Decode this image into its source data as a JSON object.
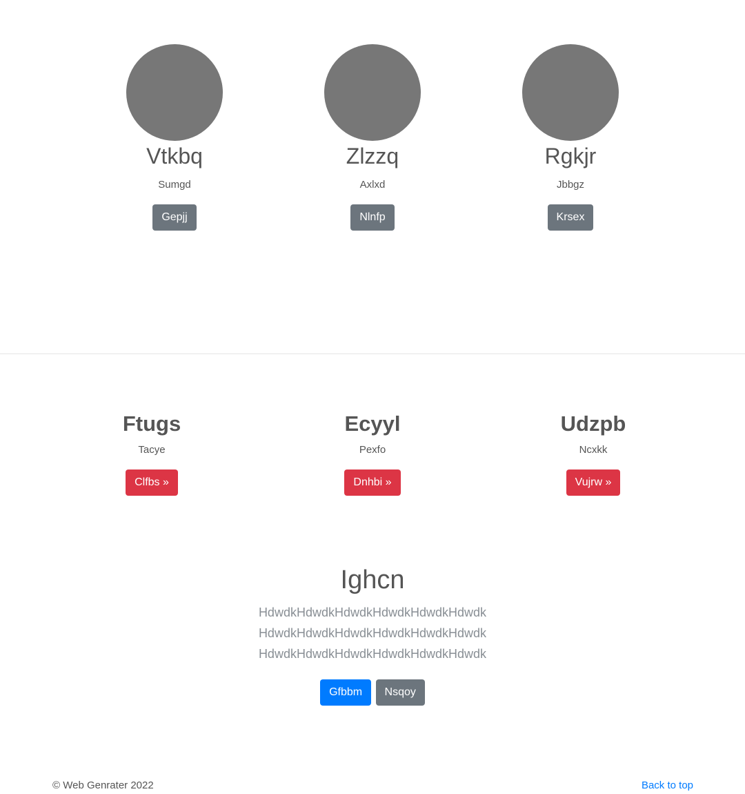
{
  "profiles": [
    {
      "name": "Vtkbq",
      "subtitle": "Sumgd",
      "button": "Gepjj"
    },
    {
      "name": "Zlzzq",
      "subtitle": "Axlxd",
      "button": "Nlnfp"
    },
    {
      "name": "Rgkjr",
      "subtitle": "Jbbgz",
      "button": "Krsex"
    }
  ],
  "features": [
    {
      "title": "Ftugs",
      "subtitle": "Tacye",
      "button": "Clfbs »"
    },
    {
      "title": "Ecyyl",
      "subtitle": "Pexfo",
      "button": "Dnhbi »"
    },
    {
      "title": "Udzpb",
      "subtitle": "Ncxkk",
      "button": "Vujrw »"
    }
  ],
  "hero": {
    "title": "Ighcn",
    "lines": [
      "HdwdkHdwdkHdwdkHdwdkHdwdkHdwdk",
      "HdwdkHdwdkHdwdkHdwdkHdwdkHdwdk",
      "HdwdkHdwdkHdwdkHdwdkHdwdkHdwdk"
    ],
    "primary_button": "Gfbbm",
    "secondary_button": "Nsqoy"
  },
  "footer": {
    "copyright": "© Web Genrater 2022",
    "back_to_top": "Back to top"
  },
  "colors": {
    "avatar": "#777777",
    "secondary": "#6c757d",
    "danger": "#dc3545",
    "primary": "#007bff"
  }
}
